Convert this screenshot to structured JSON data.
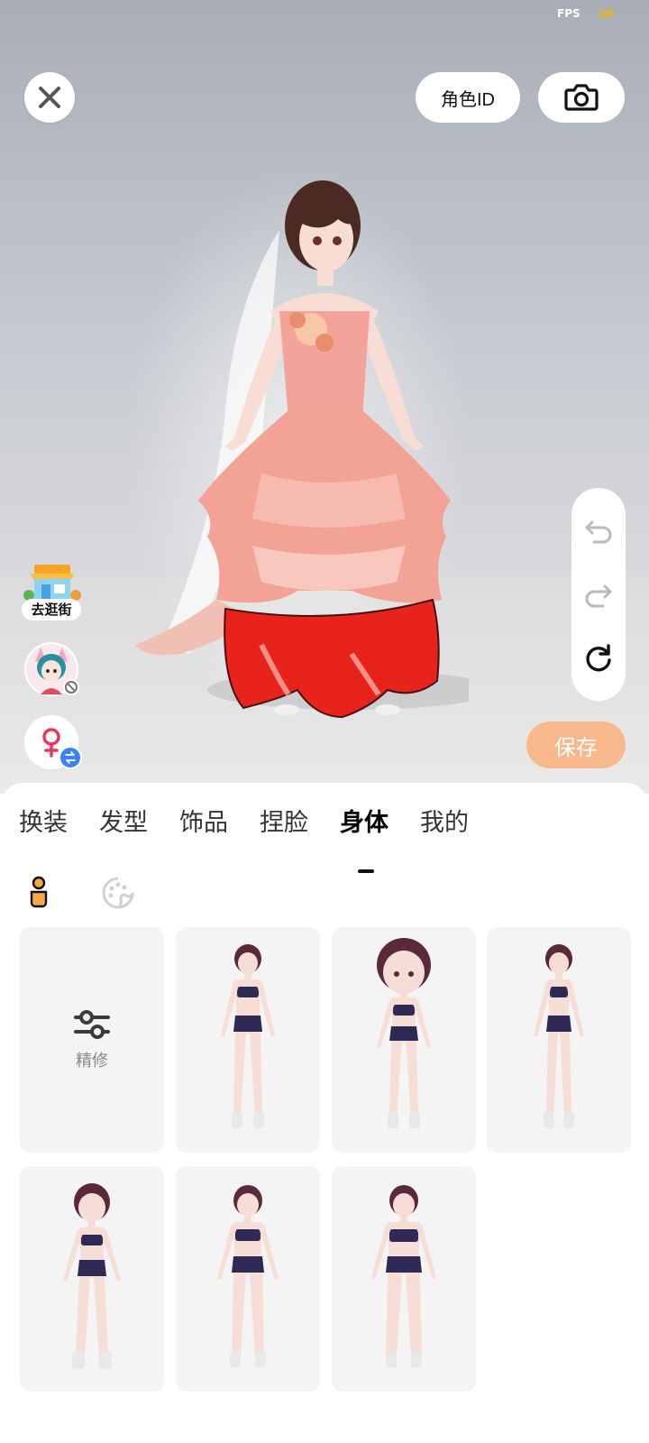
{
  "status": {
    "fps_label": "FPS",
    "fps_value": "20"
  },
  "toolbar": {
    "role_id_label": "角色ID"
  },
  "side_actions": {
    "shop_label": "去逛街"
  },
  "save_label": "保存",
  "tabs": [
    {
      "label": "换装"
    },
    {
      "label": "发型"
    },
    {
      "label": "饰品"
    },
    {
      "label": "捏脸"
    },
    {
      "label": "身体",
      "active": true
    },
    {
      "label": "我的"
    }
  ],
  "subtabs": [
    {
      "icon": "body-icon",
      "active": true
    },
    {
      "icon": "palette-icon",
      "active": false
    }
  ],
  "presets": {
    "refine_label": "精修",
    "items": [
      {
        "name": "body-preset-1",
        "head_size": "normal",
        "selected": false
      },
      {
        "name": "body-preset-2",
        "head_size": "large",
        "selected": false
      },
      {
        "name": "body-preset-3",
        "head_size": "normal",
        "selected": false
      },
      {
        "name": "body-preset-4",
        "head_size": "large",
        "selected": false
      },
      {
        "name": "body-preset-5",
        "head_size": "normal",
        "selected": false
      },
      {
        "name": "body-preset-6",
        "head_size": "normal",
        "selected": false
      }
    ]
  },
  "colors": {
    "save_button": "#f9b88c",
    "gender_badge": "#3b82f6",
    "fps_value": "#f5b400",
    "dress_primary": "#f4a39b",
    "dress_skirt": "#e8231c",
    "outfit_preset": "#2e2a55"
  }
}
